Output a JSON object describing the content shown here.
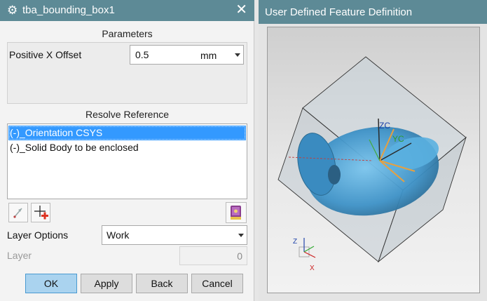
{
  "dialog": {
    "title": "tba_bounding_box1",
    "close_glyph": "✕",
    "gear_glyph": "⚙",
    "parameters": {
      "title": "Parameters",
      "offset_label": "Positive X Offset",
      "offset_value": "0.5",
      "offset_unit": "mm"
    },
    "resolve": {
      "title": "Resolve Reference",
      "items": [
        "(-)_Orientation CSYS",
        "(-)_Solid Body to be enclosed"
      ],
      "selected_index": 0
    },
    "layer_options": {
      "label": "Layer Options",
      "value": "Work"
    },
    "layer": {
      "label": "Layer",
      "value": "0"
    },
    "buttons": {
      "ok": "OK",
      "apply": "Apply",
      "back": "Back",
      "cancel": "Cancel"
    }
  },
  "graphics": {
    "title": "User Defined Feature Definition",
    "labels": {
      "zc": "ZC",
      "yc": "YC",
      "triad_z": "Z",
      "triad_x": "X"
    },
    "colors": {
      "title_bar": "#5d8a96",
      "part": "#4a9fd4",
      "selection": "#3399ff"
    }
  }
}
